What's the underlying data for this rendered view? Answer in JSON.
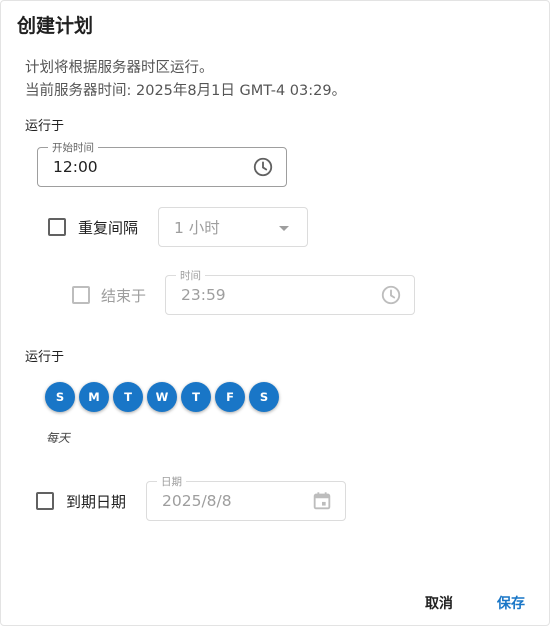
{
  "dialog": {
    "title": "创建计划",
    "description_line1": "计划将根据服务器时区运行。",
    "description_line2": "当前服务器时间: 2025年8月1日 GMT-4 03:29。"
  },
  "run_time": {
    "section_label": "运行于",
    "start_field": {
      "label": "开始时间",
      "value": "12:00",
      "icon": "clock-icon"
    },
    "repeat": {
      "label": "重复间隔",
      "checked": false,
      "interval_value": "1 小时"
    },
    "end": {
      "label": "结束于",
      "checked": false,
      "time_label": "时间",
      "time_value": "23:59",
      "icon": "clock-icon"
    }
  },
  "run_days": {
    "section_label": "运行于",
    "days": [
      "S",
      "M",
      "T",
      "W",
      "T",
      "F",
      "S"
    ],
    "summary": "每天",
    "accent_color": "#1976c7"
  },
  "expiry": {
    "label": "到期日期",
    "checked": false,
    "date_label": "日期",
    "date_value": "2025/8/8",
    "icon": "calendar-icon"
  },
  "actions": {
    "cancel_label": "取消",
    "save_label": "保存"
  }
}
